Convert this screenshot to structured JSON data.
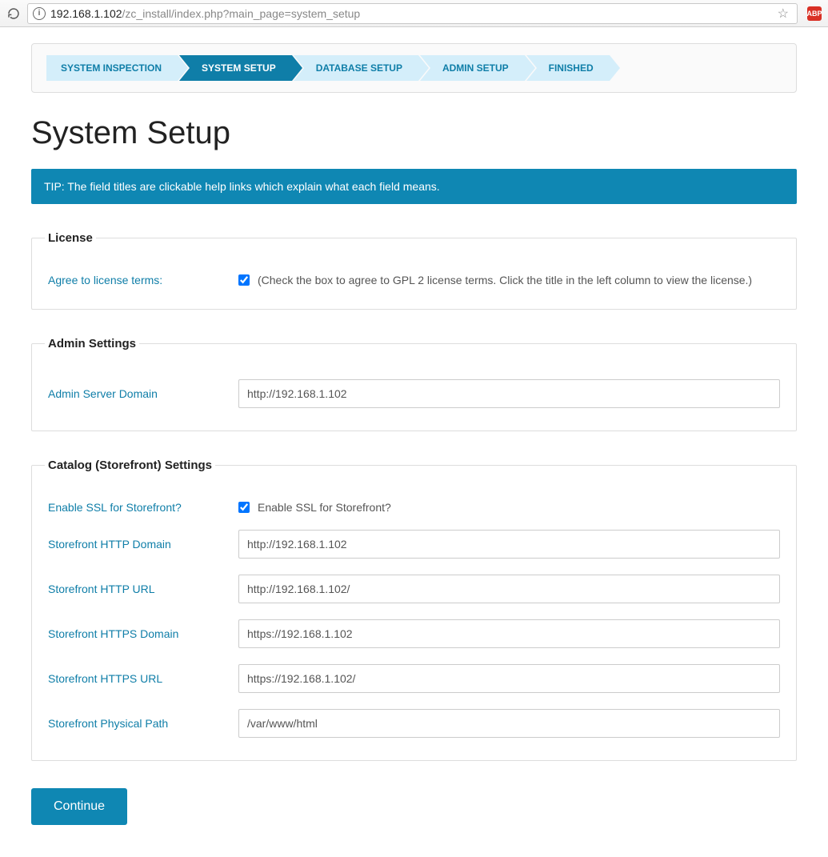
{
  "browser": {
    "url_host": "192.168.1.102",
    "url_path": "/zc_install/index.php?main_page=system_setup",
    "abp_label": "ABP"
  },
  "steps": [
    {
      "label": "SYSTEM INSPECTION",
      "active": false
    },
    {
      "label": "SYSTEM SETUP",
      "active": true
    },
    {
      "label": "DATABASE SETUP",
      "active": false
    },
    {
      "label": "ADMIN SETUP",
      "active": false
    },
    {
      "label": "FINISHED",
      "active": false
    }
  ],
  "page_title": "System Setup",
  "tip": "TIP: The field titles are clickable help links which explain what each field means.",
  "license": {
    "legend": "License",
    "agree_label": "Agree to license terms:",
    "agree_checked": true,
    "agree_text": "(Check the box to agree to GPL 2 license terms. Click the title in the left column to view the license.)"
  },
  "admin": {
    "legend": "Admin Settings",
    "server_domain_label": "Admin Server Domain",
    "server_domain_value": "http://192.168.1.102"
  },
  "catalog": {
    "legend": "Catalog (Storefront) Settings",
    "enable_ssl_label": "Enable SSL for Storefront?",
    "enable_ssl_checked": true,
    "enable_ssl_text": "Enable SSL for Storefront?",
    "http_domain_label": "Storefront HTTP Domain",
    "http_domain_value": "http://192.168.1.102",
    "http_url_label": "Storefront HTTP URL",
    "http_url_value": "http://192.168.1.102/",
    "https_domain_label": "Storefront HTTPS Domain",
    "https_domain_value": "https://192.168.1.102",
    "https_url_label": "Storefront HTTPS URL",
    "https_url_value": "https://192.168.1.102/",
    "physical_path_label": "Storefront Physical Path",
    "physical_path_value": "/var/www/html"
  },
  "continue_label": "Continue"
}
